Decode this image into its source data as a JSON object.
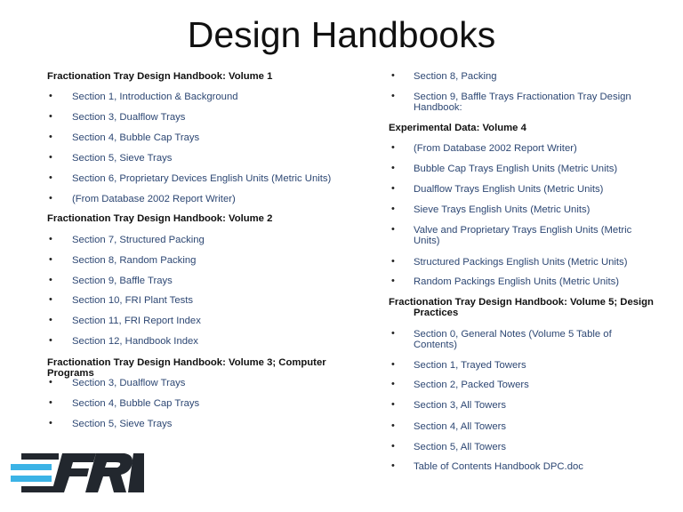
{
  "title": "Design Handbooks",
  "logo_text": "FRI",
  "colors": {
    "link": "#2d4773",
    "logo_dark": "#22272e",
    "logo_accent": "#3bb3e6"
  },
  "left_column": [
    {
      "type": "heading",
      "text": "Fractionation Tray Design Handbook: Volume 1"
    },
    {
      "type": "item",
      "text": "Section 1, Introduction & Background"
    },
    {
      "type": "item",
      "text": "Section 3, Dualflow Trays"
    },
    {
      "type": "item",
      "text": "Section 4, Bubble Cap Trays"
    },
    {
      "type": "item",
      "text": "Section 5, Sieve Trays"
    },
    {
      "type": "item",
      "text": "Section 6, Proprietary Devices English Units (Metric Units)"
    },
    {
      "type": "item",
      "text": "(From Database 2002 Report Writer)"
    },
    {
      "type": "heading",
      "text": "Fractionation Tray Design Handbook: Volume 2"
    },
    {
      "type": "item",
      "text": "Section 7, Structured Packing"
    },
    {
      "type": "item",
      "text": "Section 8, Random Packing"
    },
    {
      "type": "item",
      "text": "Section 9, Baffle Trays"
    },
    {
      "type": "item",
      "text": "Section 10, FRI Plant Tests"
    },
    {
      "type": "item",
      "text": "Section 11, FRI Report Index"
    },
    {
      "type": "item",
      "text": "Section 12, Handbook Index"
    },
    {
      "type": "heading",
      "text": "Fractionation Tray Design Handbook: Volume 3; Computer Programs"
    },
    {
      "type": "item",
      "text": "Section 3, Dualflow Trays"
    },
    {
      "type": "item",
      "text": "Section 4, Bubble Cap Trays"
    },
    {
      "type": "item",
      "text": "Section 5, Sieve Trays"
    }
  ],
  "right_column": [
    {
      "type": "item",
      "text": "Section 8, Packing"
    },
    {
      "type": "item",
      "text": "Section 9, Baffle Trays Fractionation Tray Design Handbook:"
    },
    {
      "type": "heading",
      "text": "Experimental Data: Volume 4"
    },
    {
      "type": "item",
      "text": "(From Database 2002 Report Writer)"
    },
    {
      "type": "item",
      "text": "Bubble Cap Trays English Units (Metric Units)"
    },
    {
      "type": "item",
      "text": "Dualflow Trays English Units (Metric Units)"
    },
    {
      "type": "item",
      "text": "Sieve Trays English Units (Metric Units)"
    },
    {
      "type": "item",
      "text": "Valve and Proprietary Trays English Units (Metric Units)"
    },
    {
      "type": "item",
      "text": "Structured Packings English Units (Metric Units)"
    },
    {
      "type": "item",
      "text": "Random Packings English Units (Metric Units)"
    },
    {
      "type": "heading",
      "text": "Fractionation Tray Design Handbook: Volume 5; Design Practices"
    },
    {
      "type": "item",
      "text": "Section 0, General Notes (Volume 5 Table of Contents)"
    },
    {
      "type": "item",
      "text": "Section 1, Trayed Towers"
    },
    {
      "type": "item",
      "text": "Section 2, Packed Towers"
    },
    {
      "type": "item",
      "text": "Section 3, All Towers"
    },
    {
      "type": "item",
      "text": "Section 4, All Towers"
    },
    {
      "type": "item",
      "text": "Section 5, All Towers"
    },
    {
      "type": "item",
      "text": "Table of Contents Handbook DPC.doc"
    }
  ]
}
